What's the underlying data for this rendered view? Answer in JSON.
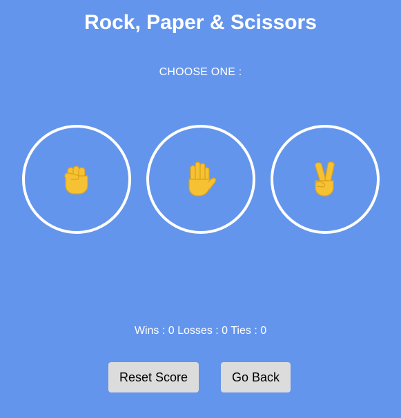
{
  "header": {
    "title": "Rock, Paper & Scissors"
  },
  "game": {
    "prompt": "CHOOSE ONE :",
    "choices": [
      {
        "name": "rock",
        "icon": "raised-fist-icon"
      },
      {
        "name": "paper",
        "icon": "raised-hand-icon"
      },
      {
        "name": "scissors",
        "icon": "victory-hand-icon"
      }
    ],
    "ring_color": "#ffffff",
    "icon_color": "#f6c132"
  },
  "score": {
    "wins_label": "Wins :",
    "wins": 0,
    "losses_label": "Losses :",
    "losses": 0,
    "ties_label": "Ties :",
    "ties": 0
  },
  "actions": {
    "reset_label": "Reset Score",
    "back_label": "Go Back"
  },
  "colors": {
    "background": "#6495ed",
    "text": "#ffffff",
    "button_bg": "#dcdcdc",
    "button_text": "#000000"
  }
}
